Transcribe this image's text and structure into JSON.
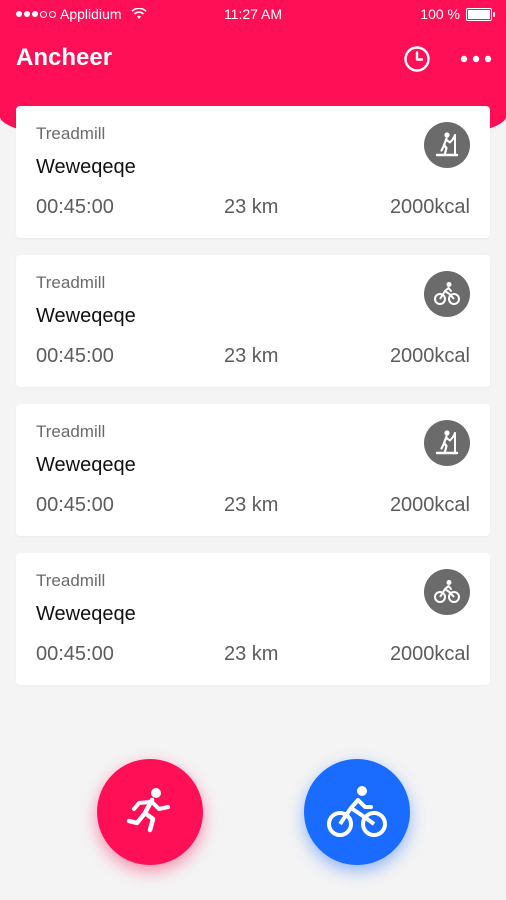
{
  "status_bar": {
    "carrier": "Applidium",
    "time": "11:27 AM",
    "battery": "100 %"
  },
  "app_bar": {
    "title": "Ancheer",
    "actions": [
      "clock-icon",
      "more-horizontal-icon"
    ]
  },
  "colors": {
    "primary": "#ff0f56",
    "secondary": "#1a6bff",
    "card_icon": "#6b6b6b"
  },
  "workouts": [
    {
      "type": "Treadmill",
      "name": "Weweqeqe",
      "duration": "00:45:00",
      "distance": "23 km",
      "calories": "2000kcal",
      "icon": "treadmill-icon"
    },
    {
      "type": "Treadmill",
      "name": "Weweqeqe",
      "duration": "00:45:00",
      "distance": "23 km",
      "calories": "2000kcal",
      "icon": "bicycle-icon"
    },
    {
      "type": "Treadmill",
      "name": "Weweqeqe",
      "duration": "00:45:00",
      "distance": "23 km",
      "calories": "2000kcal",
      "icon": "treadmill-icon"
    },
    {
      "type": "Treadmill",
      "name": "Weweqeqe",
      "duration": "00:45:00",
      "distance": "23 km",
      "calories": "2000kcal",
      "icon": "bicycle-icon"
    }
  ],
  "fabs": [
    {
      "icon": "running-icon"
    },
    {
      "icon": "bicycle-icon"
    }
  ]
}
